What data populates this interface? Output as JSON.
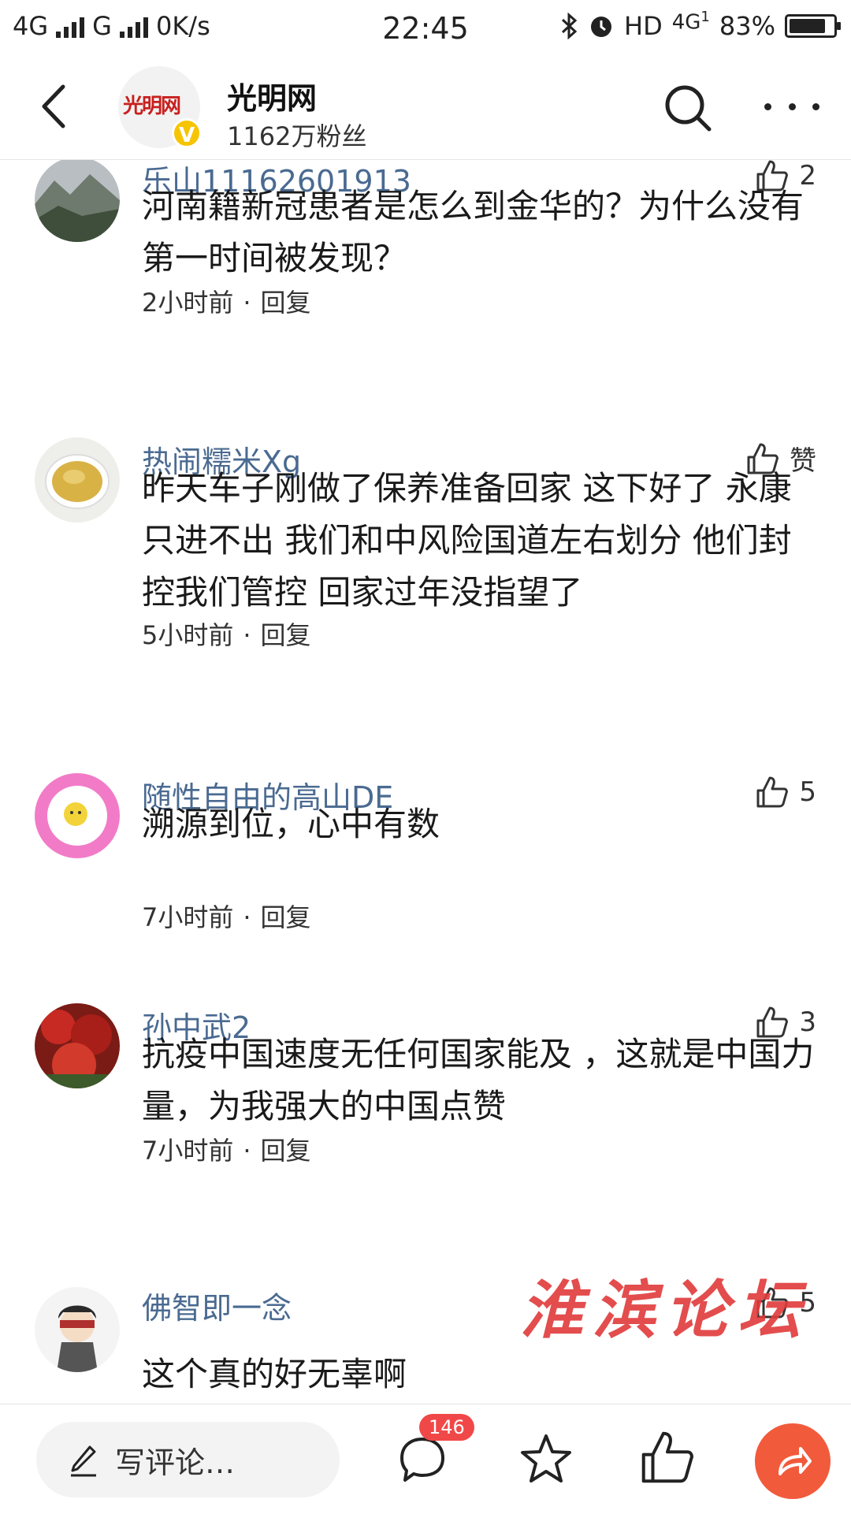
{
  "status_bar": {
    "net1": "4G",
    "net2": "G",
    "speed": "0K/s",
    "time": "22:45",
    "hd": "HD",
    "net3": "4G",
    "net3_sub": "1",
    "battery_text": "83%",
    "battery_level": 0.83
  },
  "header": {
    "back_icon": "chevron-left-icon",
    "account_name": "光明网",
    "fans": "1162万粉丝",
    "logo_text": "光明网",
    "verified_badge": "V",
    "search_icon": "search-icon",
    "more_icon": "more-icon"
  },
  "comments": [
    {
      "user": "乐山11162601913",
      "likes": "2",
      "text": "河南籍新冠患者是怎么到金华的？为什么没有第一时间被发现？",
      "time": "2小时前",
      "reply": "回复",
      "avatar": "mountain-avatar"
    },
    {
      "user": "热闹糯米Xg",
      "likes": "赞",
      "text": "昨天车子刚做了保养准备回家 这下好了 永康只进不出 我们和中风险国道左右划分 他们封控我们管控 回家过年没指望了",
      "time": "5小时前",
      "reply": "回复",
      "avatar": "tea-cup-avatar"
    },
    {
      "user": "随性自由的高山DE",
      "likes": "5",
      "text": "溯源到位，心中有数",
      "time": "7小时前",
      "reply": "回复",
      "avatar": "egg-avatar"
    },
    {
      "user": "孙中武2",
      "likes": "3",
      "text": "抗疫中国速度无任何国家能及 ，这就是中国力量，为我强大的中国点赞",
      "time": "7小时前",
      "reply": "回复",
      "avatar": "red-leaves-avatar"
    },
    {
      "user": "佛智即一念",
      "likes": "5",
      "text": "这个真的好无辜啊",
      "time": "",
      "reply": "",
      "avatar": "cartoon-figure-avatar"
    }
  ],
  "watermark": "淮滨论坛",
  "bottom_bar": {
    "input_placeholder": "写评论…",
    "comment_count": "146",
    "comment_icon": "comment-icon",
    "star_icon": "star-icon",
    "like_icon": "thumbs-up-icon",
    "share_icon": "share-icon"
  },
  "colors": {
    "username": "#4a6a91",
    "badge": "#f04848",
    "share_button": "#f25a3c",
    "verified": "#f6c400"
  }
}
